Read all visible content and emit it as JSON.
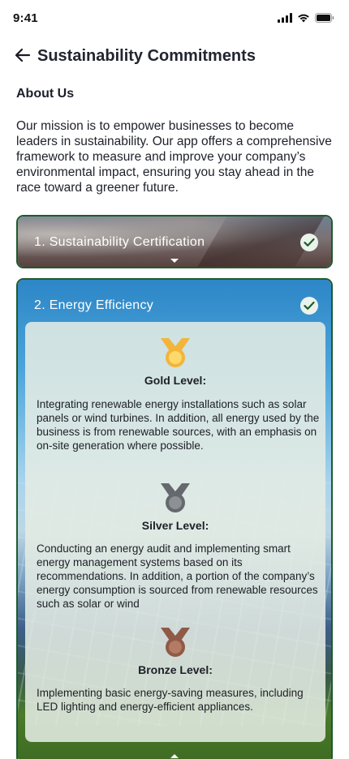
{
  "status_bar": {
    "time": "9:41"
  },
  "header": {
    "title": "Sustainability Commitments"
  },
  "about": {
    "heading": "About Us",
    "body": "Our mission is to empower businesses to become leaders in sustainability. Our app offers a comprehensive framework to measure and improve your company’s environmental impact, ensuring you stay ahead in the race toward a greener future."
  },
  "sections": [
    {
      "title": "1. Sustainability Certification",
      "completed": true,
      "expanded": false
    },
    {
      "title": "2. Energy Efficiency",
      "completed": true,
      "expanded": true,
      "levels": [
        {
          "title": "Gold Level:",
          "color": "#f2b53a",
          "description": "Integrating renewable energy installations such as solar panels or wind turbines. In addition, all energy used by the business is from renewable sources, with an emphasis on on-site generation where possible."
        },
        {
          "title": "Silver Level:",
          "color": "#6f7377",
          "description": "Conducting an energy audit and implementing smart energy management systems based on its recommendations. In addition, a portion of the company’s energy consumption is sourced from renewable resources such as solar or wind"
        },
        {
          "title": "Bronze Level:",
          "color": "#9a5f4b",
          "description": "Implementing basic energy-saving measures, including LED lighting and energy-efficient appliances."
        }
      ]
    }
  ],
  "colors": {
    "accent_green": "#1d5b2e",
    "check_green": "#1d5b2e"
  },
  "icons": [
    "signal-icon",
    "wifi-icon",
    "battery-icon",
    "back-arrow-icon",
    "check-circle-icon",
    "medal-icon",
    "chevron-down-icon",
    "chevron-up-icon"
  ]
}
